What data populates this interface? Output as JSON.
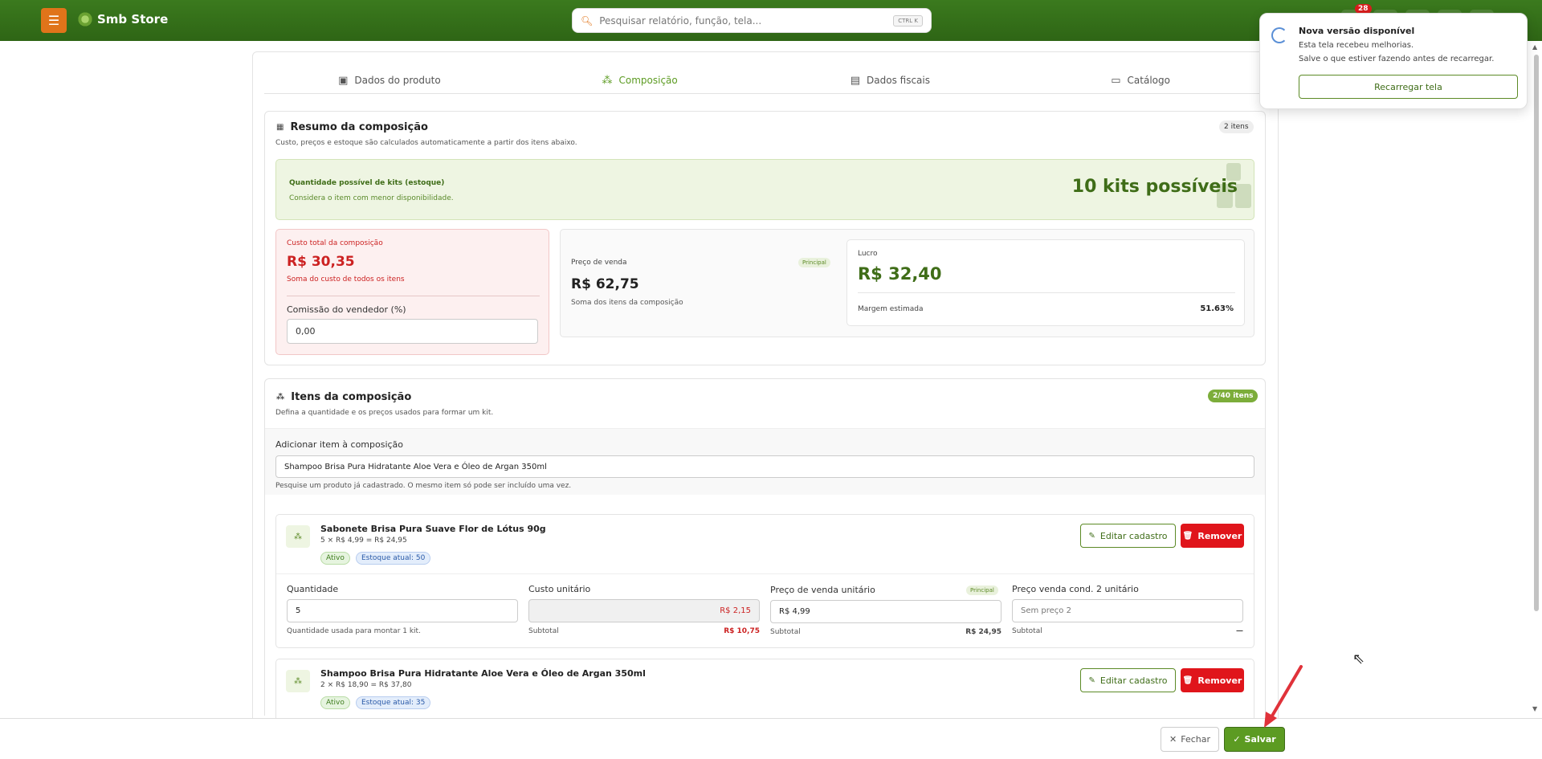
{
  "header": {
    "menu_icon": "hamburger-icon",
    "brand": "Smb Store",
    "search_placeholder": "Pesquisar relatório, função, tela...",
    "search_shortcut": "CTRL K",
    "notification_count": "28"
  },
  "tabs": [
    {
      "label": "Dados do produto",
      "icon": "box-icon"
    },
    {
      "label": "Composição",
      "icon": "boxes-icon",
      "active": true
    },
    {
      "label": "Dados fiscais",
      "icon": "document-icon"
    },
    {
      "label": "Catálogo",
      "icon": "catalog-icon"
    }
  ],
  "summary": {
    "title": "Resumo da composição",
    "description": "Custo, preços e estoque são calculados automaticamente a partir dos itens abaixo.",
    "badge": "2 itens",
    "kits_label": "Quantidade possível de kits (estoque)",
    "kits_sub": "Considera o item com menor disponibilidade.",
    "kits_value": "10 kits possíveis",
    "cost_label": "Custo total da composição",
    "cost_value": "R$ 30,35",
    "cost_sub": "Soma do custo de todos os itens",
    "commission_label": "Comissão do vendedor (%)",
    "commission_value": "0,00",
    "price_label": "Preço de venda",
    "price_badge": "Principal",
    "price_value": "R$ 62,75",
    "price_sub": "Soma dos itens da composição",
    "profit_label": "Lucro",
    "profit_value": "R$ 32,40",
    "margin_label": "Margem estimada",
    "margin_value": "51.63%"
  },
  "items_section": {
    "title": "Itens da composição",
    "description": "Defina a quantidade e os preços usados para formar um kit.",
    "badge": "2/40 itens",
    "add_label": "Adicionar item à composição",
    "add_value": "Shampoo Brisa Pura Hidratante Aloe Vera e Óleo de Argan 350ml",
    "add_help": "Pesquise um produto já cadastrado. O mesmo item só pode ser incluído uma vez."
  },
  "items": [
    {
      "name": "Sabonete Brisa Pura Suave Flor de Lótus 90g",
      "calc": "5 × R$ 4,99 = R$ 24,95",
      "status": "Ativo",
      "stock": "Estoque atual: 50",
      "edit_label": "Editar cadastro",
      "remove_label": "Remover",
      "qty_label": "Quantidade",
      "qty_value": "5",
      "qty_help": "Quantidade usada para montar 1 kit.",
      "cost_label": "Custo unitário",
      "cost_value": "R$ 2,15",
      "cost_sub_label": "Subtotal",
      "cost_sub_value": "R$ 10,75",
      "price_label": "Preço de venda unitário",
      "price_badge": "Principal",
      "price_value": "R$ 4,99",
      "price_sub_label": "Subtotal",
      "price_sub_value": "R$ 24,95",
      "price2_label": "Preço venda cond. 2 unitário",
      "price2_placeholder": "Sem preço 2",
      "price2_sub_label": "Subtotal",
      "price2_sub_value": "—"
    },
    {
      "name": "Shampoo Brisa Pura Hidratante Aloe Vera e Óleo de Argan 350ml",
      "calc": "2 × R$ 18,90 = R$ 37,80",
      "status": "Ativo",
      "stock": "Estoque atual: 35",
      "edit_label": "Editar cadastro",
      "remove_label": "Remover"
    }
  ],
  "footer": {
    "close_label": "Fechar",
    "save_label": "Salvar"
  },
  "toast": {
    "title": "Nova versão disponível",
    "line1": "Esta tela recebeu melhorias.",
    "line2": "Salve o que estiver fazendo antes de recarregar.",
    "button": "Recarregar tela"
  },
  "colors": {
    "brand_green": "#3b7a1e",
    "accent_orange": "#e0741a",
    "danger_red": "#e0151b",
    "arrow_red": "#e0323a"
  }
}
